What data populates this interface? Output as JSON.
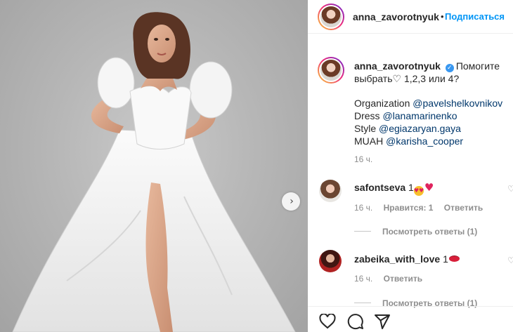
{
  "header": {
    "username": "anna_zavorotnyuk",
    "separator": "•",
    "follow_label": "Подписаться"
  },
  "caption": {
    "username": "anna_zavorotnyuk",
    "text_part1": "Помогите",
    "text_part2": "выбрать",
    "text_part3": "1,2,3 или 4?",
    "credits": [
      {
        "label": "Organization ",
        "mention": "@pavelshelkovnikov"
      },
      {
        "label": "Dress ",
        "mention": "@lanamarinenko"
      },
      {
        "label": "Style ",
        "mention": "@egiazaryan.gaya"
      },
      {
        "label": "MUAH ",
        "mention": "@karisha_cooper"
      }
    ],
    "time": "16 ч."
  },
  "comments": [
    {
      "username": "safontseva",
      "text": "1",
      "emojis": [
        "heart-eyes-icon",
        "red-heart-icon"
      ],
      "time": "16 ч.",
      "likes": "Нравится: 1",
      "reply": "Ответить",
      "view_replies": "Посмотреть ответы (1)"
    },
    {
      "username": "zabeika_with_love",
      "text": "1",
      "emojis": [
        "lips-icon"
      ],
      "time": "16 ч.",
      "reply": "Ответить",
      "view_replies": "Посмотреть ответы (1)"
    }
  ],
  "colors": {
    "follow": "#0095f6",
    "mention": "#00376b",
    "verified": "#3897f0",
    "meta": "#8e8e8e"
  }
}
